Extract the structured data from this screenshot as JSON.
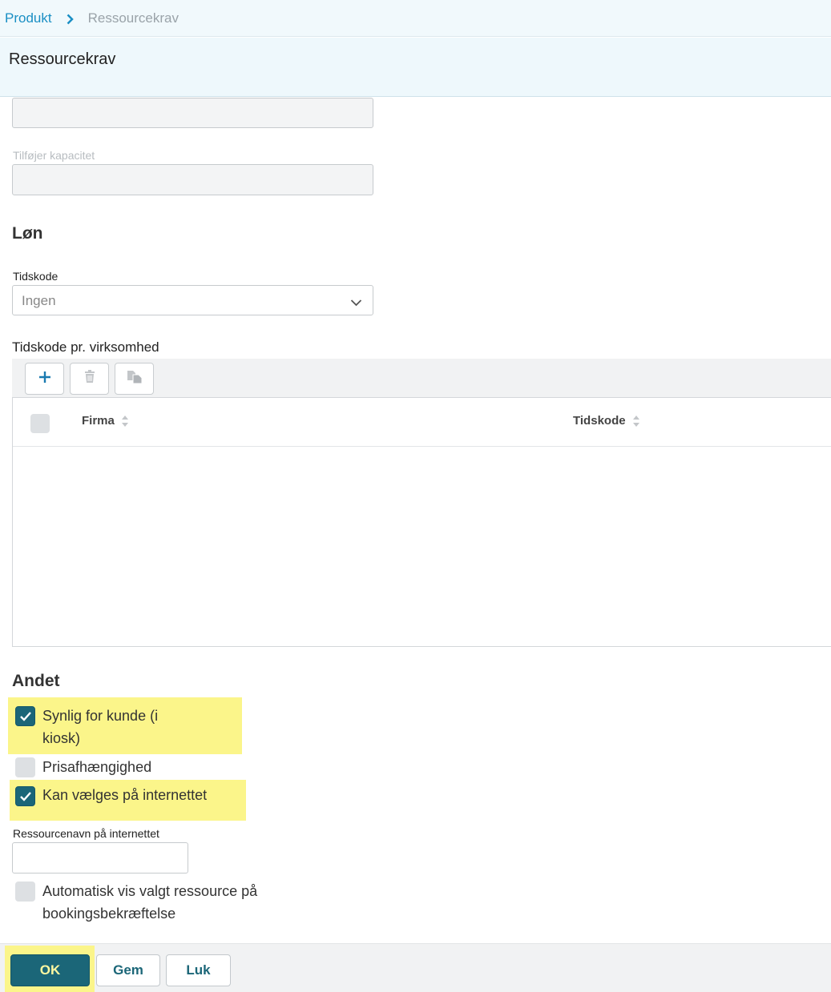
{
  "breadcrumb": {
    "parent": "Produkt",
    "current": "Ressourcekrav"
  },
  "header": {
    "title": "Ressourcekrav"
  },
  "fields": {
    "unnamed_value": "",
    "capacity_label": "Tilføjer kapacitet",
    "capacity_value": ""
  },
  "salary": {
    "section_title": "Løn",
    "timecode_label": "Tidskode",
    "timecode_value": "Ingen",
    "per_company_label": "Tidskode pr. virksomhed",
    "grid_columns": [
      "Firma",
      "Tidskode"
    ],
    "toolbar_icons": [
      "plus-icon",
      "trash-icon",
      "copy-icon"
    ]
  },
  "other": {
    "section_title": "Andet",
    "visible_customer_line1": "Synlig for kunde (i",
    "visible_customer_line2": "kiosk)",
    "price_dependency": "Prisafhængighed",
    "selectable_online": "Kan vælges på internettet",
    "resource_name_label": "Ressourcenavn på internettet",
    "resource_name_value": "",
    "auto_show_line1": "Automatisk vis valgt ressource på",
    "auto_show_line2": "bookingsbekræftelse"
  },
  "checks": {
    "visible_customer": true,
    "price_dependency": false,
    "selectable_online": true,
    "auto_show": false
  },
  "footer": {
    "ok": "OK",
    "save": "Gem",
    "close": "Luk"
  },
  "colors": {
    "accent": "#1b6678",
    "link": "#1a8fc4",
    "highlight": "#fbf58a"
  }
}
